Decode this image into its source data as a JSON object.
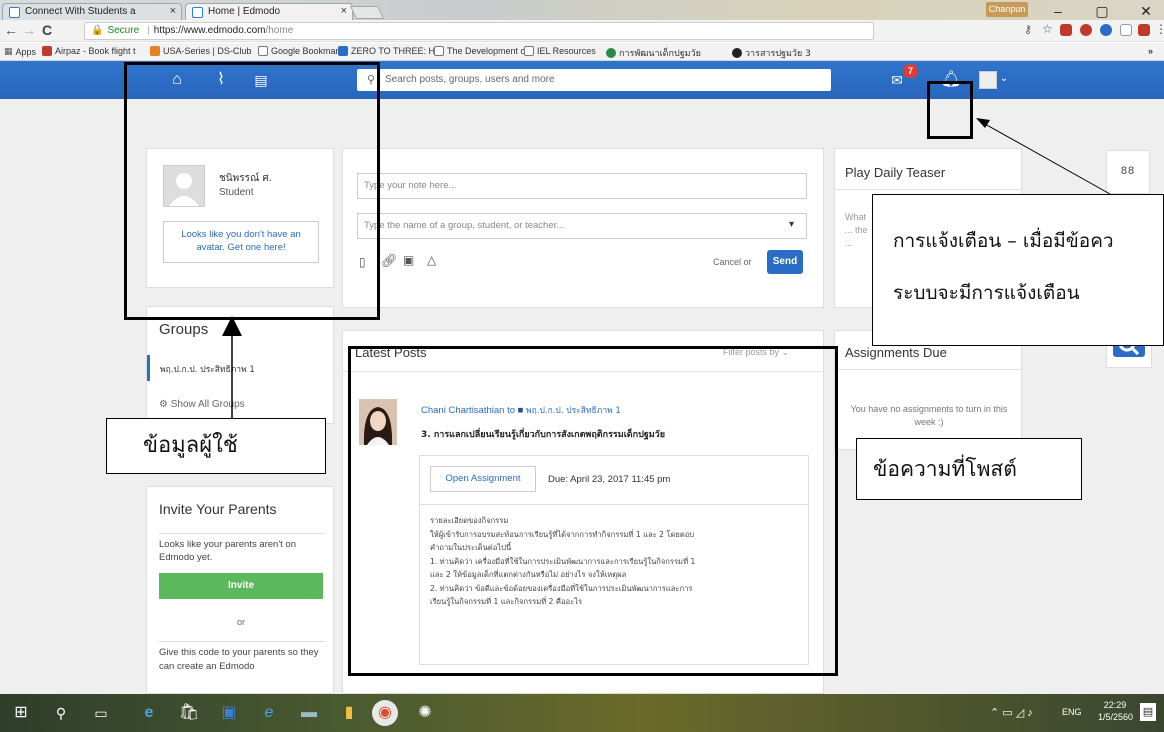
{
  "browser": {
    "tabs": [
      {
        "title": "Connect With Students a",
        "active": false
      },
      {
        "title": "Home | Edmodo",
        "active": true
      }
    ],
    "profile": "Chanpun",
    "url_secure": "Secure",
    "url_host": "https://www.edmodo.com",
    "url_path": "/home",
    "bookmarks": [
      "Apps",
      "Airpaz - Book flight t",
      "USA-Series | DS-Club",
      "Google Bookmark",
      "ZERO TO THREE: Hel",
      "The Development of",
      "IEL Resources",
      "การพัฒนาเด็กปฐมวัย",
      "วารสารปฐมวัย 3"
    ]
  },
  "header": {
    "search_placeholder": "Search posts, groups, users and more",
    "notification_count": "7"
  },
  "profile_card": {
    "name": "ชนิพรรณ์ ศ.",
    "role": "Student",
    "avatar_notice": "Looks like you don't have an avatar. Get one here!"
  },
  "groups": {
    "title": "Groups",
    "items": [
      "พฤ.ป.ก.ป. ประสิทธิภาพ 1"
    ],
    "show_all": "Show All Groups"
  },
  "invite": {
    "title": "Invite Your Parents",
    "text": "Looks like your parents aren't on Edmodo yet.",
    "button": "Invite",
    "or": "or",
    "code_text": "Give this code to your parents so they can create an Edmodo"
  },
  "composer": {
    "note_placeholder": "Type your note here...",
    "to_placeholder": "Type the name of a group, student, or teacher...",
    "cancel": "Cancel or",
    "send": "Send"
  },
  "feed": {
    "title": "Latest Posts",
    "filter": "Filter posts by",
    "post": {
      "author": "Chani Chartisathian to",
      "group": "พฤ.ป.ก.ป. ประสิทธิภาพ 1",
      "title": "3. การแลกเปลี่ยนเรียนรู้เกี่ยวกับการสังเกตพฤติกรรมเด็กปฐมวัย",
      "open_button": "Open Assignment",
      "due": "Due: April 23, 2017 11:45 pm",
      "body": [
        "รายละเอียดของกิจกรรม",
        "ให้ผู้เข้ารับการอบรมสะท้อนการเรียนรู้ที่ได้จากการทำกิจกรรมที่ 1 และ 2 โดยตอบ",
        "คำถามในประเด็นต่อไปนี้",
        "1. ท่านคิดว่า เครื่องมือที่ใช้ในการประเมินพัฒนาการและการเรียนรู้ในกิจกรรมที่ 1",
        "และ 2 ให้ข้อมูลเด็กที่แตกต่างกันหรือไม่ อย่างไร จงให้เหตุผล",
        "2. ท่านคิดว่า ข้อดีและข้อด้อยของเครื่องมือที่ใช้ในการประเมินพัฒนาการและการ",
        "เรียนรู้ในกิจกรรมที่ 1 และกิจกรรมที่ 2 คืออะไร"
      ]
    }
  },
  "right_rail": {
    "teaser_title": "Play Daily Teaser",
    "teaser_text": "What ... the ...",
    "assignments_title": "Assignments Due",
    "assignments_text": "You have no assignments to turn in this week :)",
    "apps_icon": "88"
  },
  "annotations": {
    "notify_line1": "การแจ้งเตือน – เมื่อมีข้อคว",
    "notify_line2": "ระบบจะมีการแจ้งเตือน",
    "user_info": "ข้อมูลผู้ใช้",
    "posted_msg": "ข้อความที่โพสต์"
  },
  "taskbar": {
    "lang": "ENG",
    "time": "22:29",
    "date": "1/5/2560"
  },
  "colors": {
    "header_blue": "#2b6cc4",
    "badge_red": "#e03c31",
    "invite_green": "#5cb85c"
  }
}
